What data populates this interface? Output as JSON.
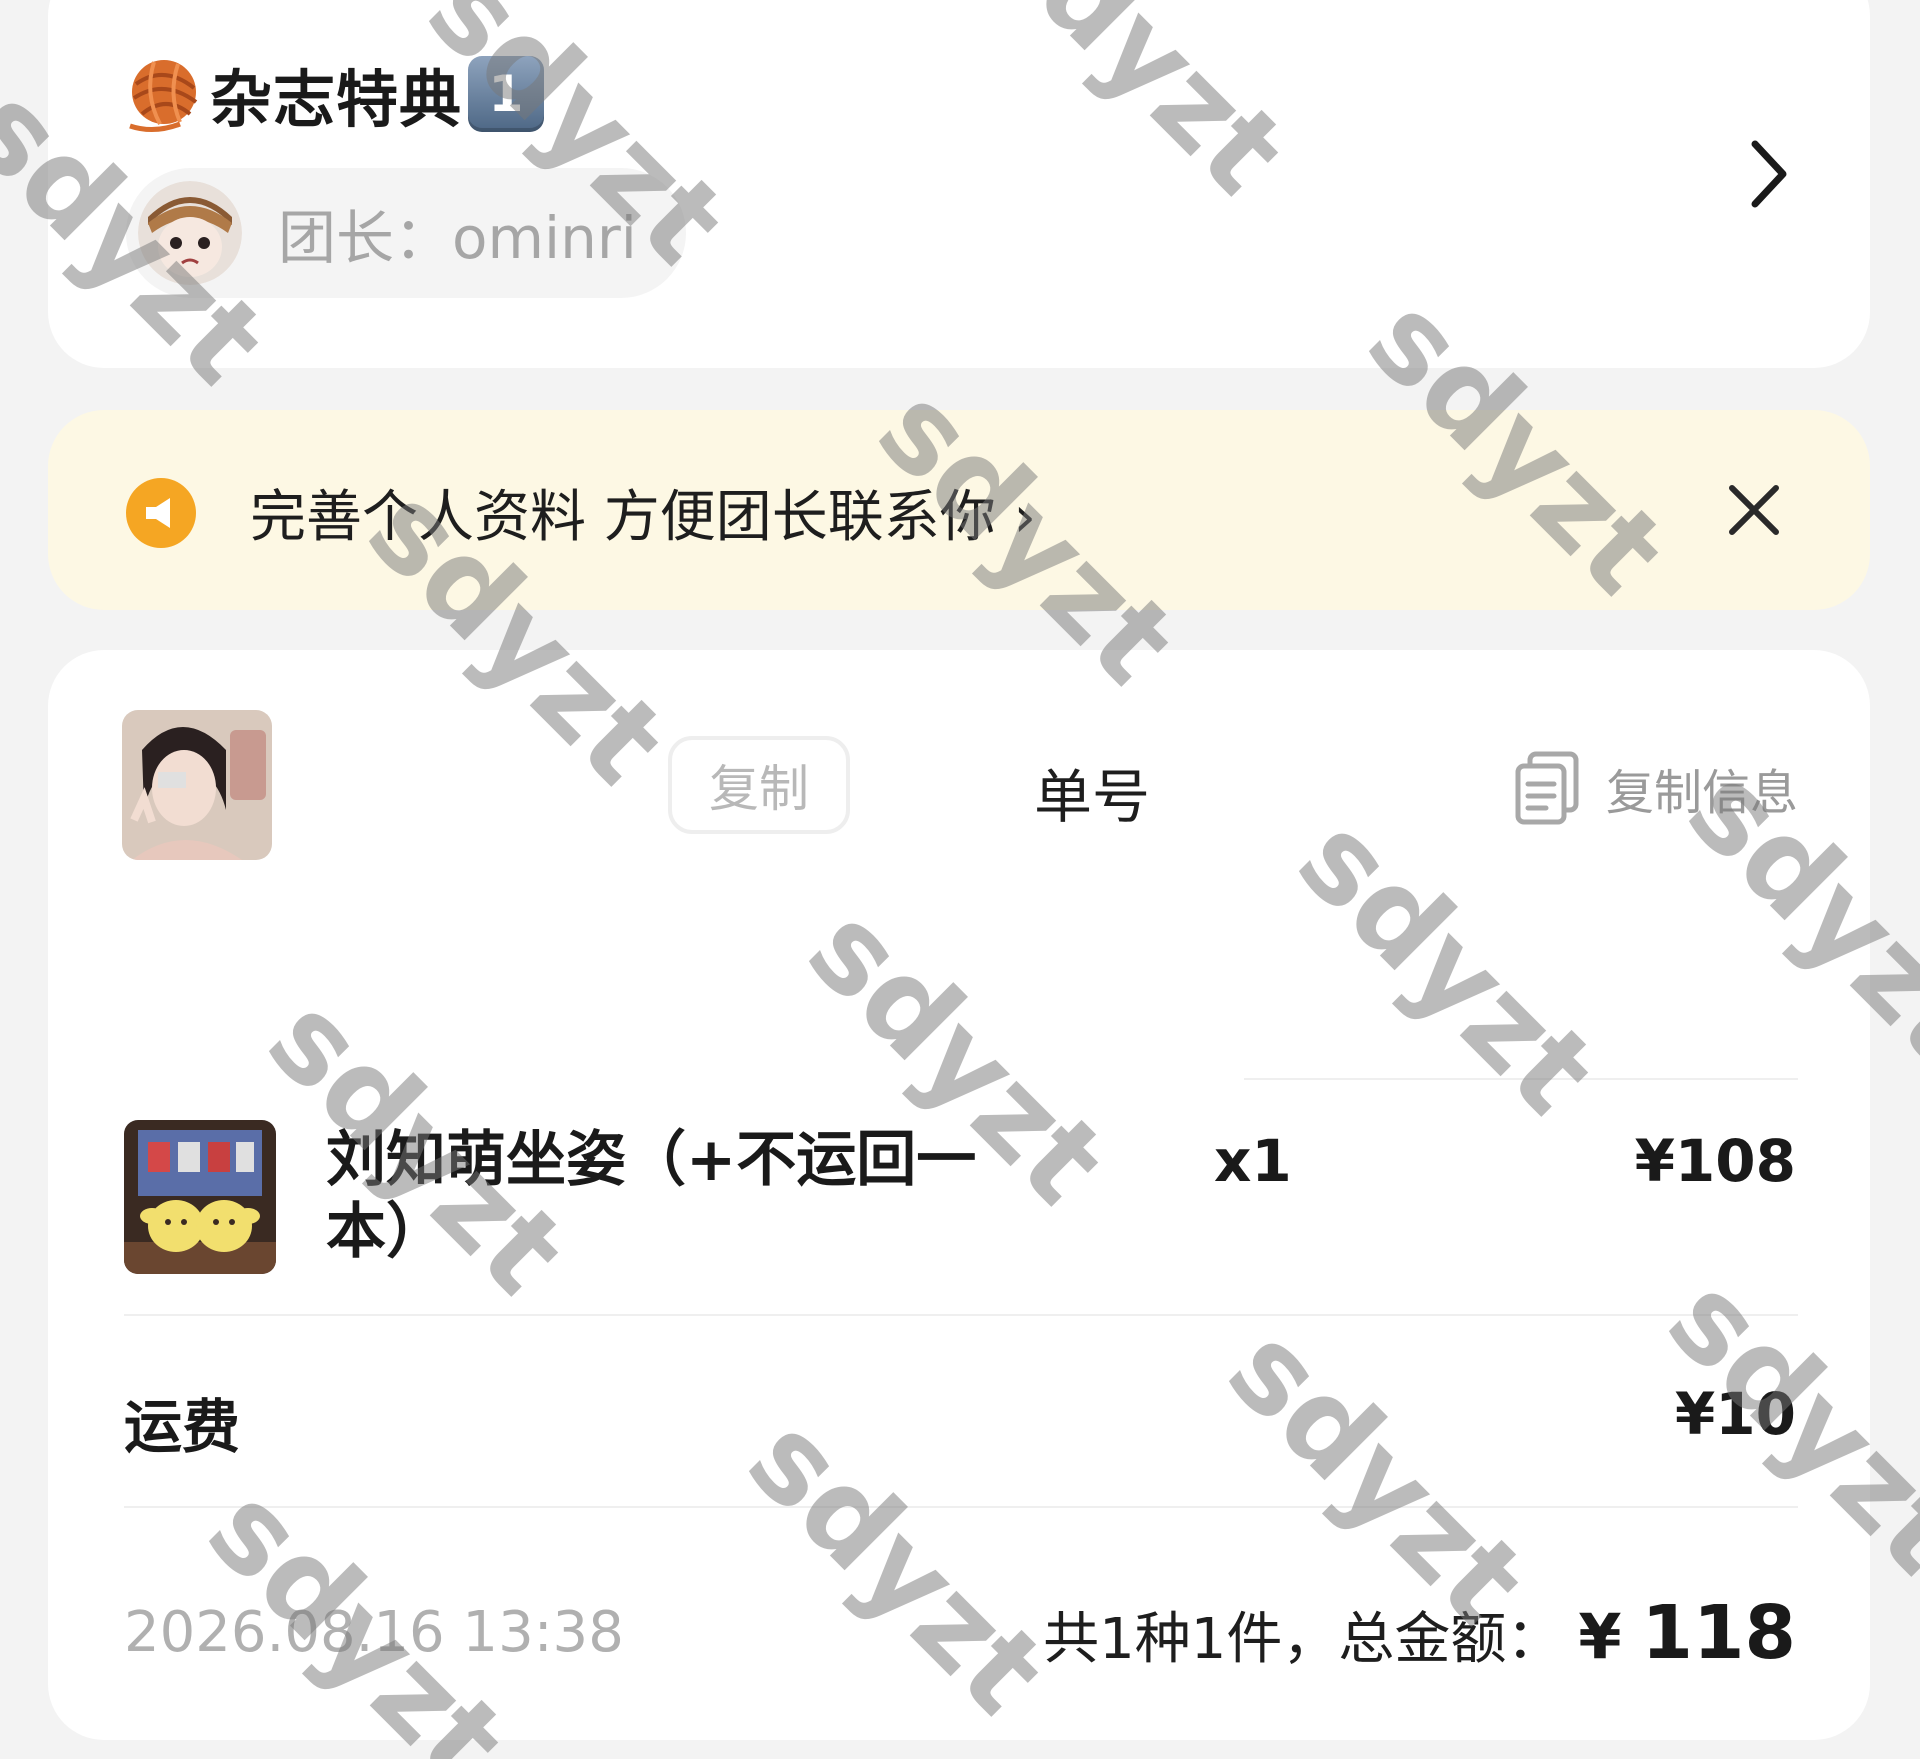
{
  "group": {
    "name": "杂志特典",
    "badge": "1",
    "leader": "团长：ominri"
  },
  "notice": {
    "text": "完善个人资料 方便团长联系你 ›"
  },
  "order": {
    "copy_button": "复制",
    "order_no_label": "单号",
    "copy_info": "复制信息",
    "item": {
      "name": "刘知萌坐姿（+不运回一本）",
      "qty": "x1",
      "price": "¥108"
    },
    "shipping": {
      "label": "运费",
      "price": "¥10"
    },
    "time": "2026.08.16 13:38",
    "summary": {
      "text": "共1种1件，总金额：",
      "currency": "¥",
      "total": "118"
    }
  },
  "watermark": "sdyzt",
  "colors": {
    "notice_bg": "#fdf8e4",
    "notice_icon": "#f5a623",
    "yarn": "#d96d2c"
  }
}
